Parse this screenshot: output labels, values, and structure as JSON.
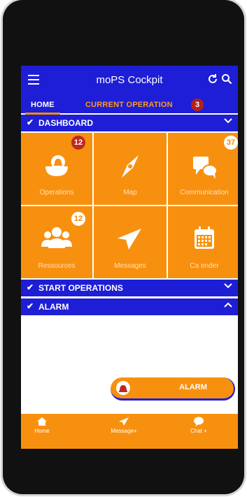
{
  "header": {
    "title": "moPS Cockpit"
  },
  "tabs": {
    "home": "HOME",
    "current": "CURRENT OPERATION",
    "current_badge": "3"
  },
  "sections": {
    "dashboard": "DASHBOARD",
    "start_operations": "START OPERATIONS",
    "alarm": "ALARM"
  },
  "tiles": {
    "operations": {
      "label": "Operations",
      "count": "12"
    },
    "map": {
      "label": "Map"
    },
    "communication": {
      "label": "Communication",
      "count": "37"
    },
    "resources": {
      "label": "Ressources",
      "count": "12"
    },
    "messages": {
      "label": "Messages"
    },
    "calendar": {
      "label": "Ca ender"
    }
  },
  "alarm_button": {
    "label": "ALARM"
  },
  "bottom_nav": {
    "home": "Home",
    "messages": "Message+",
    "chat": "Chat +"
  },
  "colors": {
    "blue": "#1e1ed6",
    "orange": "#f8900f",
    "red": "#c0281f"
  }
}
